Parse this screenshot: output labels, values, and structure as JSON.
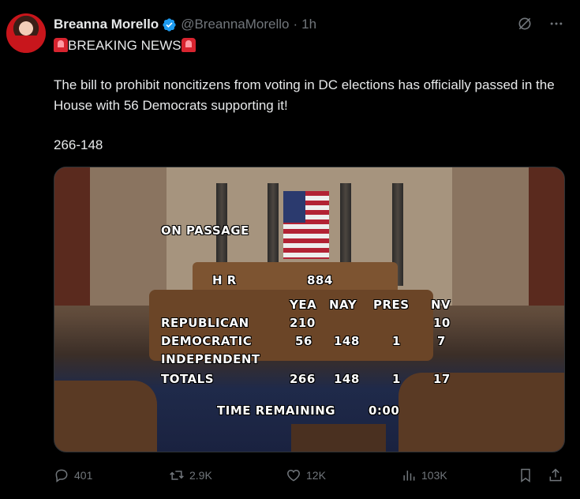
{
  "author": {
    "name": "Breanna Morello",
    "handle": "@BreannaMorello",
    "separator": "·",
    "time": "1h"
  },
  "header_icons": [
    "grok-icon",
    "more-icon"
  ],
  "tweet": {
    "headline": "BREAKING NEWS",
    "body": "The bill to prohibit noncitizens from voting in DC elections has officially passed in the House with 56 Democrats supporting it!",
    "tally": "266-148"
  },
  "media": {
    "on_passage": "ON PASSAGE",
    "hr_label": "H R",
    "hr_number": "884",
    "col_yea": "YEA",
    "col_nay": "NAY",
    "col_pres": "PRES",
    "col_nv": "NV",
    "rows": [
      {
        "party": "REPUBLICAN",
        "yea": "210",
        "nay": "",
        "pres": "",
        "nv": "10"
      },
      {
        "party": "DEMOCRATIC",
        "yea": "56",
        "nay": "148",
        "pres": "1",
        "nv": "7"
      },
      {
        "party": "INDEPENDENT",
        "yea": "",
        "nay": "",
        "pres": "",
        "nv": ""
      },
      {
        "party": "TOTALS",
        "yea": "266",
        "nay": "148",
        "pres": "1",
        "nv": "17"
      }
    ],
    "time_remaining_label": "TIME REMAINING",
    "time_remaining_value": "0:00"
  },
  "actions": {
    "replies": "401",
    "reposts": "2.9K",
    "likes": "12K",
    "views": "103K"
  },
  "colors": {
    "background": "#000000",
    "text": "#e7e9ea",
    "muted": "#71767b",
    "verified": "#1d9bf0"
  }
}
